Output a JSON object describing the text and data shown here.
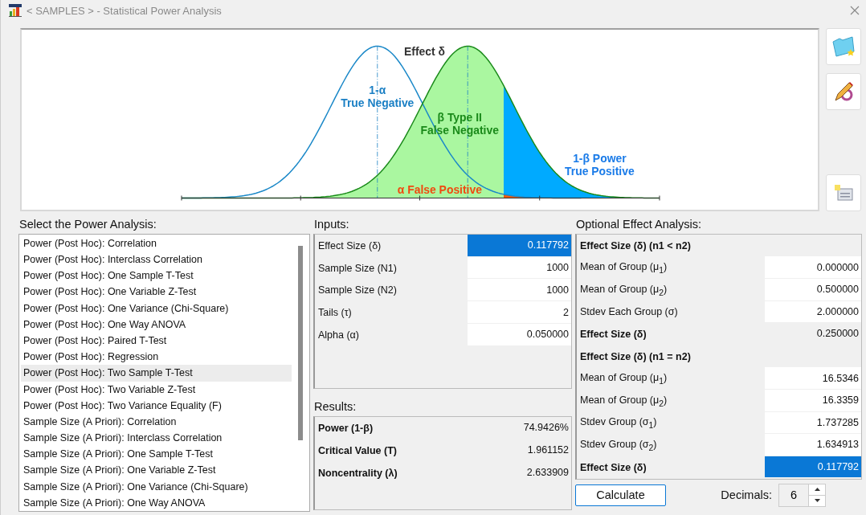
{
  "window": {
    "title": "< SAMPLES > - Statistical Power Analysis"
  },
  "diagram": {
    "labels": [
      {
        "kind": "effect",
        "lines": [
          "Effect δ"
        ]
      },
      {
        "kind": "true_negative",
        "lines": [
          "1-α",
          "True Negative"
        ]
      },
      {
        "kind": "type_two",
        "lines": [
          "β Type II",
          "False Negative"
        ]
      },
      {
        "kind": "power",
        "lines": [
          "1-β Power",
          "True Positive"
        ]
      },
      {
        "kind": "false_positive",
        "lines": [
          "α False Positive"
        ]
      }
    ]
  },
  "analysis_list": {
    "label": "Select the Power Analysis:",
    "items": [
      {
        "text": "Power (Post Hoc): Correlation",
        "selected": false
      },
      {
        "text": "Power (Post Hoc): Interclass Correlation",
        "selected": false
      },
      {
        "text": "Power (Post Hoc): One Sample T-Test",
        "selected": false
      },
      {
        "text": "Power (Post Hoc): One Variable Z-Test",
        "selected": false
      },
      {
        "text": "Power (Post Hoc): One Variance (Chi-Square)",
        "selected": false
      },
      {
        "text": "Power (Post Hoc): One Way ANOVA",
        "selected": false
      },
      {
        "text": "Power (Post Hoc): Paired T-Test",
        "selected": false
      },
      {
        "text": "Power (Post Hoc): Regression",
        "selected": false
      },
      {
        "text": "Power (Post Hoc): Two Sample T-Test",
        "selected": true
      },
      {
        "text": "Power (Post Hoc): Two Variable Z-Test",
        "selected": false
      },
      {
        "text": "Power (Post Hoc): Two Variance Equality (F)",
        "selected": false
      },
      {
        "text": "Sample Size (A Priori): Correlation",
        "selected": false
      },
      {
        "text": "Sample Size (A Priori): Interclass Correlation",
        "selected": false
      },
      {
        "text": "Sample Size (A Priori): One Sample T-Test",
        "selected": false
      },
      {
        "text": "Sample Size (A Priori): One Variable Z-Test",
        "selected": false
      },
      {
        "text": "Sample Size (A Priori): One Variance (Chi-Square)",
        "selected": false
      },
      {
        "text": "Sample Size (A Priori): One Way ANOVA",
        "selected": false
      }
    ]
  },
  "inputs": {
    "label": "Inputs:",
    "rows": [
      {
        "label": "Effect Size (δ)",
        "value": "0.117792",
        "selected": true
      },
      {
        "label": "Sample Size (N1)",
        "value": "1000",
        "selected": false
      },
      {
        "label": "Sample Size (N2)",
        "value": "1000",
        "selected": false
      },
      {
        "label": "Tails (τ)",
        "value": "2",
        "selected": false
      },
      {
        "label": "Alpha (α)",
        "value": "0.050000",
        "selected": false
      }
    ]
  },
  "results": {
    "label": "Results:",
    "rows": [
      {
        "label": "Power (1-β)",
        "value": "74.9426%"
      },
      {
        "label": "Critical Value (T)",
        "value": "1.961152"
      },
      {
        "label": "Noncentrality (λ)",
        "value": "2.633909"
      }
    ]
  },
  "effect_analysis": {
    "label": "Optional Effect Analysis:",
    "rows": [
      {
        "kind": "header",
        "label": "Effect Size (δ) (n1 < n2)"
      },
      {
        "kind": "input",
        "label": "Mean of Group (μ$_{1}$)",
        "value": "0.000000",
        "selected": false
      },
      {
        "kind": "input",
        "label": "Mean of Group (μ$_{2}$)",
        "value": "0.500000",
        "selected": false
      },
      {
        "kind": "input",
        "label": "Stdev Each Group (σ)",
        "value": "2.000000",
        "selected": false
      },
      {
        "kind": "result",
        "label": "Effect Size (δ)",
        "value": "0.250000",
        "selected": false
      },
      {
        "kind": "header",
        "label": "Effect Size (δ) (n1 = n2)"
      },
      {
        "kind": "input",
        "label": "Mean of Group (μ$_{1}$)",
        "value": "16.5346",
        "selected": false
      },
      {
        "kind": "input",
        "label": "Mean of Group (μ$_{2}$)",
        "value": "16.3359",
        "selected": false
      },
      {
        "kind": "input",
        "label": "Stdev Group (σ$_{1}$)",
        "value": "1.737285",
        "selected": false
      },
      {
        "kind": "input",
        "label": "Stdev Group (σ$_{2}$)",
        "value": "1.634913",
        "selected": false
      },
      {
        "kind": "result",
        "label": "Effect Size (δ)",
        "value": "0.117792",
        "selected": true
      }
    ]
  },
  "calculate_button": "Calculate",
  "decimals": {
    "label": "Decimals:",
    "value": "6"
  }
}
